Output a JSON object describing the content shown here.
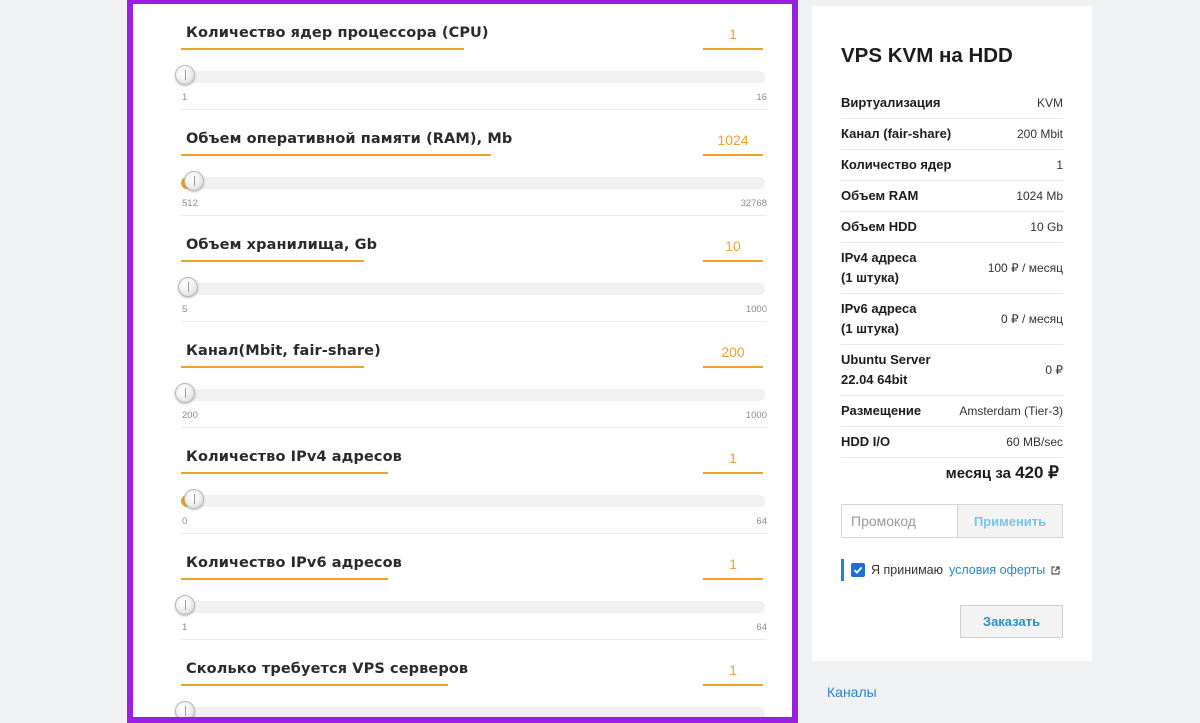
{
  "config": {
    "rows": [
      {
        "label": "Количество ядер процессора (CPU)",
        "value": "1",
        "min": "1",
        "max": "16",
        "level": 0
      },
      {
        "label": "Объем оперативной памяти (RAM), Mb",
        "value": "1024",
        "min": "512",
        "max": "32768",
        "level": 0.016
      },
      {
        "label": "Объем хранилища, Gb",
        "value": "10",
        "min": "5",
        "max": "1000",
        "level": 0.005
      },
      {
        "label": "Канал(Mbit, fair-share)",
        "value": "200",
        "min": "200",
        "max": "1000",
        "level": 0
      },
      {
        "label": "Количество IPv4 адресов",
        "value": "1",
        "min": "0",
        "max": "64",
        "level": 0.016
      },
      {
        "label": "Количество IPv6 адресов",
        "value": "1",
        "min": "1",
        "max": "64",
        "level": 0
      },
      {
        "label": "Сколько требуется VPS серверов",
        "value": "1",
        "min": "",
        "max": "",
        "level": 0
      }
    ]
  },
  "summary": {
    "title": "VPS KVM на HDD",
    "specs": [
      {
        "key": "Виртуализация",
        "value": "KVM"
      },
      {
        "key": "Канал (fair-share)",
        "value": "200 Mbit"
      },
      {
        "key": "Количество ядер",
        "value": "1"
      },
      {
        "key": "Объем RAM",
        "value": "1024 Mb"
      },
      {
        "key": "Объем HDD",
        "value": "10 Gb"
      },
      {
        "key": "IPv4 адреса\n(1 штука)",
        "value": "100 ₽ / месяц"
      },
      {
        "key": "IPv6 адреса\n(1 штука)",
        "value": "0 ₽ / месяц"
      },
      {
        "key": "Ubuntu Server\n22.04 64bit",
        "value": "0 ₽"
      },
      {
        "key": "Размещение",
        "value": "Amsterdam (Tier-3)"
      },
      {
        "key": "HDD I/O",
        "value": "60 MB/sec"
      }
    ],
    "total_prefix": "месяц за",
    "total_amount": "420 ₽",
    "promo_placeholder": "Промокод",
    "promo_button": "Применить",
    "offer_text": "Я принимаю",
    "offer_link": "условия оферты",
    "order_button": "Заказать"
  },
  "footer": {
    "channels_link": "Каналы"
  },
  "colors": {
    "accent_orange": "#f0a12b",
    "frame_purple": "#9b1fe0",
    "link_blue": "#2a85c8"
  }
}
